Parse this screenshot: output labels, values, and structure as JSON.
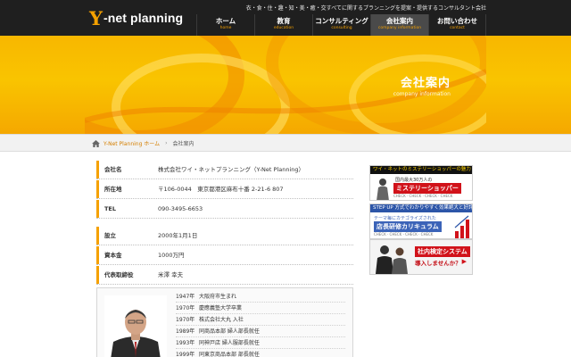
{
  "header": {
    "logo_mark": "Y",
    "logo_text": "-net planning",
    "tagline": "衣・食・住・趣・知・美・癒・交すべてに関するプランニングを提案・提供するコンサルタント会社",
    "nav": [
      {
        "jp": "ホーム",
        "en": "home"
      },
      {
        "jp": "教育",
        "en": "education"
      },
      {
        "jp": "コンサルティング",
        "en": "consulting"
      },
      {
        "jp": "会社案内",
        "en": "company information"
      },
      {
        "jp": "お問い合わせ",
        "en": "contact"
      }
    ]
  },
  "hero": {
    "title": "会社案内",
    "subtitle": "company information"
  },
  "breadcrumb": {
    "home": "Y-Net Planning ホーム",
    "current": "会社案内"
  },
  "company": {
    "rows": [
      {
        "label": "会社名",
        "value": "株式会社ワイ・ネットプランニング（Y-Net Planning）"
      },
      {
        "label": "所在地",
        "value": "〒106-0044　東京都港区麻布十番 2-21-6 807"
      },
      {
        "label": "TEL",
        "value": "090-3495-6653"
      },
      {
        "label": "設立",
        "value": "2000年1月1日"
      },
      {
        "label": "資本金",
        "value": "1000万円"
      },
      {
        "label": "代表取締役",
        "value": "米澤 幸夫"
      }
    ]
  },
  "history": [
    {
      "year": "1947年",
      "event": "大阪府市生まれ"
    },
    {
      "year": "1970年",
      "event": "慶應義塾大学卒業"
    },
    {
      "year": "1970年",
      "event": "株式会社大丸 入社"
    },
    {
      "year": "1989年",
      "event": "同商品本部 婦人部長就任"
    },
    {
      "year": "1993年",
      "event": "同神戸店 婦人服部長就任"
    },
    {
      "year": "1999年",
      "event": "同東京商品本部 部長就任"
    }
  ],
  "banners": {
    "b1": {
      "bar": "ワイ・ネットのミステリーショッパーの魅力",
      "small": "国内最大30万人の",
      "big": "ミステリーショッパー",
      "check": "CHECK · CHECK · CHECK · CHECK"
    },
    "b2": {
      "bar": "STEP UP 方式でわかりやすく効果絶大と好評！",
      "small": "テーマ毎にカテゴライズされた",
      "big": "店長研修カリキュラム",
      "check": "CHECK · CHECK · CHECK · CHECK"
    },
    "b3": {
      "big": "社内検定システム",
      "small": "導入しませんか？",
      "arrow": "▶"
    }
  },
  "colors": {
    "accent": "#f5a100",
    "header_bg": "#1f1f1f",
    "hero_bg": "#f9c400",
    "link": "#d47f00"
  }
}
